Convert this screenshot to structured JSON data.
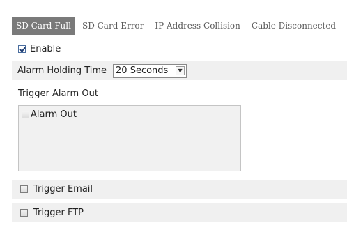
{
  "tabs": [
    {
      "label": "SD Card Full",
      "active": true
    },
    {
      "label": "SD Card Error",
      "active": false
    },
    {
      "label": "IP Address Collision",
      "active": false
    },
    {
      "label": "Cable Disconnected",
      "active": false
    }
  ],
  "enable": {
    "label": "Enable",
    "checked": true
  },
  "alarm_holding": {
    "label": "Alarm Holding Time",
    "selected": "20 Seconds",
    "arrow_icon": "chevron-down-icon"
  },
  "trigger_alarm_out": {
    "title": "Trigger Alarm Out",
    "items": [
      {
        "label": "Alarm Out",
        "checked": false
      }
    ]
  },
  "trigger_email": {
    "label": "Trigger Email",
    "checked": false
  },
  "trigger_ftp": {
    "label": "Trigger FTP",
    "checked": false
  },
  "colors": {
    "active_tab": "#7a7a7a",
    "row_shade": "#f0f0f0",
    "box_bg": "#f1f1f1"
  }
}
